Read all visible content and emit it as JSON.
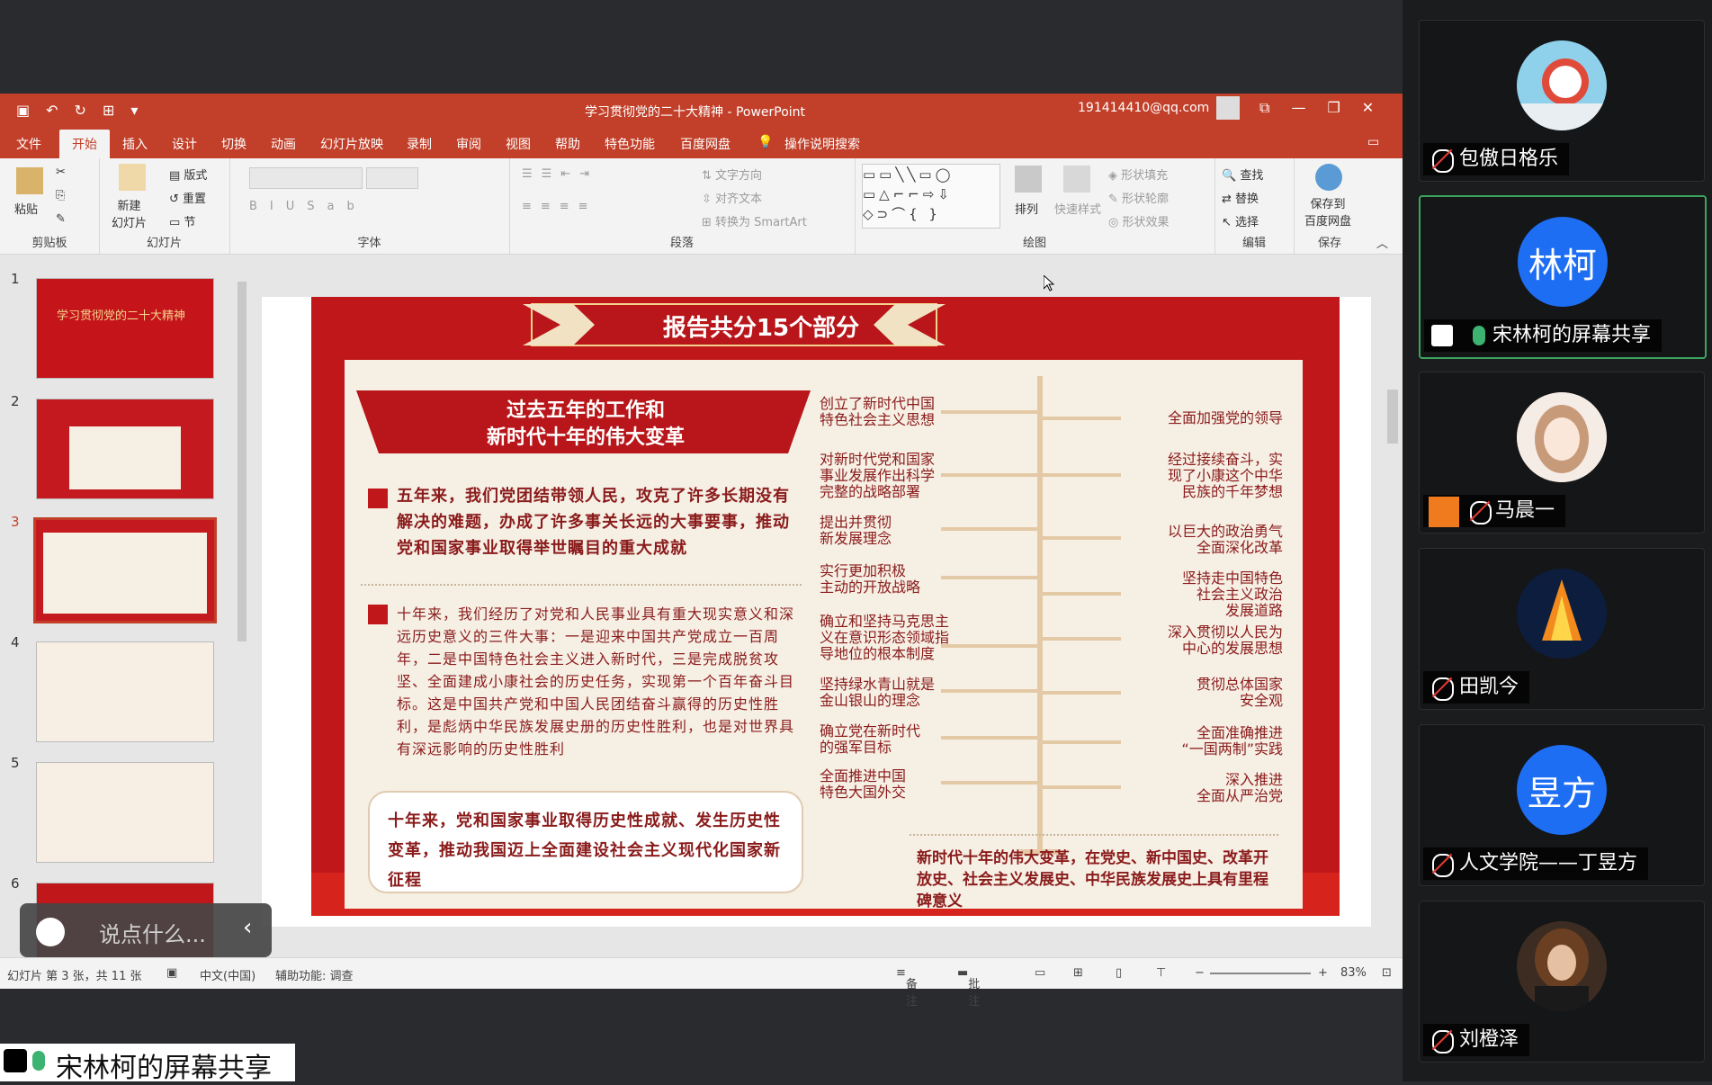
{
  "window": {
    "title": "学习贯彻党的二十大精神  -  PowerPoint",
    "user_email": "191414410@qq.com"
  },
  "tabs": [
    "文件",
    "开始",
    "插入",
    "设计",
    "切换",
    "动画",
    "幻灯片放映",
    "录制",
    "审阅",
    "视图",
    "帮助",
    "特色功能",
    "百度网盘",
    "操作说明搜索"
  ],
  "ribbon": {
    "clipboard": {
      "paste": "粘贴",
      "label": "剪贴板"
    },
    "slides": {
      "new_slide": "新建\n幻灯片",
      "layout": "版式",
      "reset": "重置",
      "section": "节",
      "label": "幻灯片"
    },
    "font": {
      "label": "字体"
    },
    "paragraph": {
      "text_direction": "文字方向",
      "align_text": "对齐文本",
      "smartart": "转换为 SmartArt",
      "label": "段落"
    },
    "drawing": {
      "arrange": "排列",
      "quick_styles": "快速样式",
      "shape_fill": "形状填充",
      "shape_outline": "形状轮廓",
      "shape_effects": "形状效果",
      "label": "绘图"
    },
    "editing": {
      "find": "查找",
      "replace": "替换",
      "select": "选择",
      "label": "编辑"
    },
    "save": {
      "save_baidu": "保存到\n百度网盘",
      "label": "保存"
    }
  },
  "thumbnails": [
    {
      "num": "1",
      "title": "学习贯彻党的二十大精神"
    },
    {
      "num": "2",
      "title": ""
    },
    {
      "num": "3",
      "title": ""
    },
    {
      "num": "4",
      "title": ""
    },
    {
      "num": "5",
      "title": ""
    },
    {
      "num": "6",
      "title": ""
    }
  ],
  "slide": {
    "header": "报告共分15个部分",
    "left_banner": "过去五年的工作和\n新时代十年的伟大变革",
    "para1": "五年来，我们党团结带领人民，攻克了许多长期没有解决的难题，办成了许多事关长远的大事要事，推动党和国家事业取得举世瞩目的重大成就",
    "para2": "十年来，我们经历了对党和人民事业具有重大现实意义和深远历史意义的三件大事：一是迎来中国共产党成立一百周年，二是中国特色社会主义进入新时代，三是完成脱贫攻坚、全面建成小康社会的历史任务，实现第一个百年奋斗目标。这是中国共产党和中国人民团结奋斗赢得的历史性胜利，是彪炳中华民族发展史册的历史性胜利，也是对世界具有深远影响的历史性胜利",
    "box": "十年来，党和国家事业取得历史性成就、发生历史性变革，推动我国迈上全面建设社会主义现代化国家新征程",
    "left_items": [
      "创立了新时代中国\n特色社会主义思想",
      "对新时代党和国家\n事业发展作出科学\n完整的战略部署",
      "提出并贯彻\n新发展理念",
      "实行更加积极\n主动的开放战略",
      "确立和坚持马克思主\n义在意识形态领域指\n导地位的根本制度",
      "坚持绿水青山就是\n金山银山的理念",
      "确立党在新时代\n的强军目标",
      "全面推进中国\n特色大国外交"
    ],
    "right_items": [
      "全面加强党的领导",
      "经过接续奋斗，实\n现了小康这个中华\n民族的千年梦想",
      "以巨大的政治勇气\n全面深化改革",
      "坚持走中国特色\n社会主义政治\n发展道路",
      "深入贯彻以人民为\n中心的发展思想",
      "贯彻总体国家\n安全观",
      "全面准确推进\n“一国两制”实践",
      "深入推进\n全面从严治党"
    ],
    "footer_text": "新时代十年的伟大变革，在党史、新中国史、改革开放史、社会主义发展史、中华民族发展史上具有里程碑意义"
  },
  "status": {
    "slide_info": "幻灯片 第 3 张，共 11 张",
    "language": "中文(中国)",
    "accessibility": "辅助功能: 调查",
    "notes": "备注",
    "comments": "批注",
    "zoom": "83%"
  },
  "chat": {
    "placeholder": "说点什么..."
  },
  "share_label": "宋林柯的屏幕共享",
  "participants": [
    {
      "name": "包傲日格乐",
      "avatar": "image",
      "mic": "off"
    },
    {
      "name": "宋林柯的屏幕共享",
      "avatar_text": "林柯",
      "mic": "on",
      "active": true
    },
    {
      "name": "马晨一",
      "avatar": "image",
      "mic": "off"
    },
    {
      "name": "田凯今",
      "avatar": "image",
      "mic": "off"
    },
    {
      "name": "人文学院——丁昱方",
      "avatar_text": "昱方",
      "mic": "off"
    },
    {
      "name": "刘橙泽",
      "avatar": "image",
      "mic": "off"
    }
  ],
  "colors": {
    "ppt_accent": "#c2402a",
    "slide_red": "#c0171b",
    "avatar_blue": "#1e6ef4",
    "active_green": "#3ba55d"
  }
}
